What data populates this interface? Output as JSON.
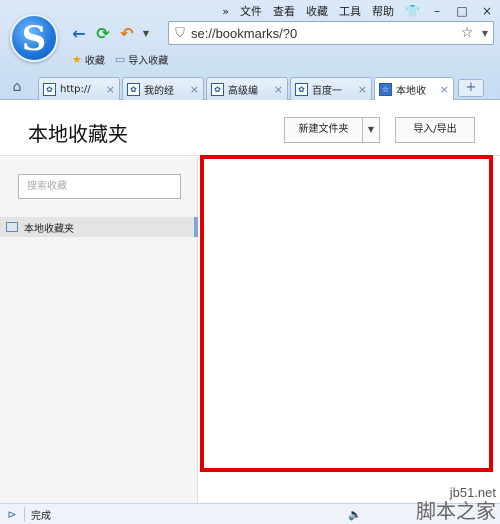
{
  "menu": {
    "overflow": "»",
    "items": [
      "文件",
      "查看",
      "收藏",
      "工具",
      "帮助"
    ],
    "skin_icon": "shirt-icon"
  },
  "window": {
    "minimize": "–",
    "maximize": "□",
    "close": "×"
  },
  "logo": {
    "letter": "S"
  },
  "address": {
    "url": "se://bookmarks/?0"
  },
  "favbar": {
    "favorites": "收藏",
    "import": "导入收藏"
  },
  "tabs": [
    {
      "title": "http://",
      "icon": "paw-icon",
      "active": false
    },
    {
      "title": "我的经",
      "icon": "paw-icon",
      "active": false
    },
    {
      "title": "高级编",
      "icon": "paw-icon",
      "active": false
    },
    {
      "title": "百度一",
      "icon": "paw-icon",
      "active": false
    },
    {
      "title": "本地收",
      "icon": "star-icon",
      "active": true
    }
  ],
  "newtab": "+",
  "page": {
    "title": "本地收藏夹",
    "new_folder": "新建文件夹",
    "import_export": "导入/导出",
    "search_placeholder": "搜索收藏",
    "sidebar_item": "本地收藏夹"
  },
  "status": {
    "text": "完成"
  },
  "watermark": {
    "line1": "jb51.net",
    "line2": "脚本之家"
  },
  "colors": {
    "highlight_box": "#e00000",
    "accent": "#1e66c8"
  }
}
